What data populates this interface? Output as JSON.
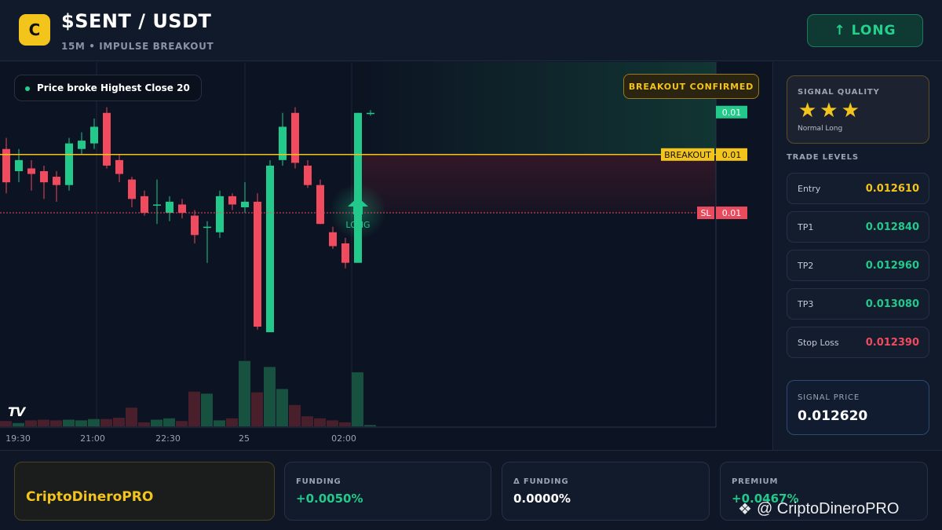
{
  "header": {
    "logo_letter": "C",
    "title": "$SENT / USDT",
    "subtitle": "15M • IMPULSE BREAKOUT",
    "long_button": "↑ LONG"
  },
  "chart": {
    "chip_text": "Price broke Highest Close 20",
    "confirmed_badge": "BREAKOUT CONFIRMED",
    "tv_logo": "TV",
    "long_marker": "LONG",
    "breakout_label": "BREAKOUT",
    "breakout_value": "0.01",
    "top_value": "0.01",
    "sl_label": "SL",
    "sl_value": "0.01",
    "time_labels": [
      "19:30",
      "21:00",
      "22:30",
      "25",
      "02:00"
    ],
    "colors": {
      "up": "#22c98a",
      "down": "#f04a5e",
      "breakout": "#f3c41c",
      "sl": "#e84a5e"
    }
  },
  "chart_data": {
    "type": "candlestick",
    "breakout_level": 0.0126,
    "stop_loss": 0.01239,
    "candles": [
      {
        "o": 0.01262,
        "h": 0.01266,
        "l": 0.01246,
        "c": 0.0125,
        "v": 0.8
      },
      {
        "o": 0.01254,
        "h": 0.01262,
        "l": 0.0125,
        "c": 0.01258,
        "v": 0.5
      },
      {
        "o": 0.01255,
        "h": 0.01258,
        "l": 0.01247,
        "c": 0.01253,
        "v": 0.9
      },
      {
        "o": 0.01254,
        "h": 0.01256,
        "l": 0.01244,
        "c": 0.0125,
        "v": 1.0
      },
      {
        "o": 0.01252,
        "h": 0.01254,
        "l": 0.01243,
        "c": 0.01249,
        "v": 0.9
      },
      {
        "o": 0.01249,
        "h": 0.01266,
        "l": 0.01247,
        "c": 0.01264,
        "v": 1.0
      },
      {
        "o": 0.01262,
        "h": 0.01268,
        "l": 0.0126,
        "c": 0.01265,
        "v": 0.9
      },
      {
        "o": 0.01264,
        "h": 0.01273,
        "l": 0.01262,
        "c": 0.0127,
        "v": 1.1
      },
      {
        "o": 0.01275,
        "h": 0.01277,
        "l": 0.01255,
        "c": 0.01256,
        "v": 1.1
      },
      {
        "o": 0.01258,
        "h": 0.0126,
        "l": 0.0125,
        "c": 0.01253,
        "v": 1.3
      },
      {
        "o": 0.01251,
        "h": 0.01252,
        "l": 0.01241,
        "c": 0.01244,
        "v": 2.8
      },
      {
        "o": 0.01245,
        "h": 0.01247,
        "l": 0.01238,
        "c": 0.01239,
        "v": 0.6
      },
      {
        "o": 0.01242,
        "h": 0.01251,
        "l": 0.01235,
        "c": 0.01242,
        "v": 1.0
      },
      {
        "o": 0.01239,
        "h": 0.01245,
        "l": 0.01236,
        "c": 0.01243,
        "v": 1.2
      },
      {
        "o": 0.01242,
        "h": 0.01244,
        "l": 0.01237,
        "c": 0.01239,
        "v": 0.8
      },
      {
        "o": 0.01238,
        "h": 0.0124,
        "l": 0.01228,
        "c": 0.01231,
        "v": 5.2
      },
      {
        "o": 0.01234,
        "h": 0.01236,
        "l": 0.01221,
        "c": 0.01234,
        "v": 4.9
      },
      {
        "o": 0.01232,
        "h": 0.01247,
        "l": 0.0123,
        "c": 0.01245,
        "v": 0.9
      },
      {
        "o": 0.01245,
        "h": 0.01246,
        "l": 0.0124,
        "c": 0.01242,
        "v": 1.2
      },
      {
        "o": 0.01241,
        "h": 0.0125,
        "l": 0.01239,
        "c": 0.01243,
        "v": 9.8
      },
      {
        "o": 0.01243,
        "h": 0.01246,
        "l": 0.01197,
        "c": 0.01198,
        "v": 5.1
      },
      {
        "o": 0.01196,
        "h": 0.01258,
        "l": 0.01196,
        "c": 0.01256,
        "v": 8.9
      },
      {
        "o": 0.01258,
        "h": 0.01275,
        "l": 0.01256,
        "c": 0.0127,
        "v": 5.6
      },
      {
        "o": 0.01275,
        "h": 0.01277,
        "l": 0.01255,
        "c": 0.01257,
        "v": 3.2
      },
      {
        "o": 0.01256,
        "h": 0.01258,
        "l": 0.01248,
        "c": 0.01249,
        "v": 1.5
      },
      {
        "o": 0.01249,
        "h": 0.01251,
        "l": 0.01235,
        "c": 0.01235,
        "v": 1.2
      },
      {
        "o": 0.01232,
        "h": 0.01234,
        "l": 0.01226,
        "c": 0.01227,
        "v": 0.9
      },
      {
        "o": 0.01228,
        "h": 0.0123,
        "l": 0.01219,
        "c": 0.01221,
        "v": 0.6
      },
      {
        "o": 0.01221,
        "h": 0.01275,
        "l": 0.01221,
        "c": 0.01275,
        "v": 8.1
      },
      {
        "o": 0.01275,
        "h": 0.01276,
        "l": 0.01274,
        "c": 0.01275,
        "v": 0.2
      }
    ]
  },
  "signal_quality": {
    "label": "SIGNAL QUALITY",
    "stars": "★★★",
    "rating": 3,
    "type": "Normal Long"
  },
  "trade_levels": {
    "title": "TRADE LEVELS",
    "items": [
      {
        "label": "Entry",
        "value": "0.012610",
        "color": "#f3c41c"
      },
      {
        "label": "TP1",
        "value": "0.012840",
        "color": "#22c98a"
      },
      {
        "label": "TP2",
        "value": "0.012960",
        "color": "#22c98a"
      },
      {
        "label": "TP3",
        "value": "0.013080",
        "color": "#22c98a"
      },
      {
        "label": "Stop Loss",
        "value": "0.012390",
        "color": "#f04a5e"
      }
    ]
  },
  "signal_price": {
    "label": "SIGNAL PRICE",
    "value": "0.012620"
  },
  "footer": {
    "brand": "CriptoDineroPRO",
    "funding_label": "FUNDING",
    "funding_value": "+0.0050%",
    "delta_label": "Δ FUNDING",
    "delta_value": "0.0000%",
    "premium_label": "PREMIUM",
    "premium_value": "+0.0467%",
    "watermark": "@ CriptoDineroPRO"
  }
}
